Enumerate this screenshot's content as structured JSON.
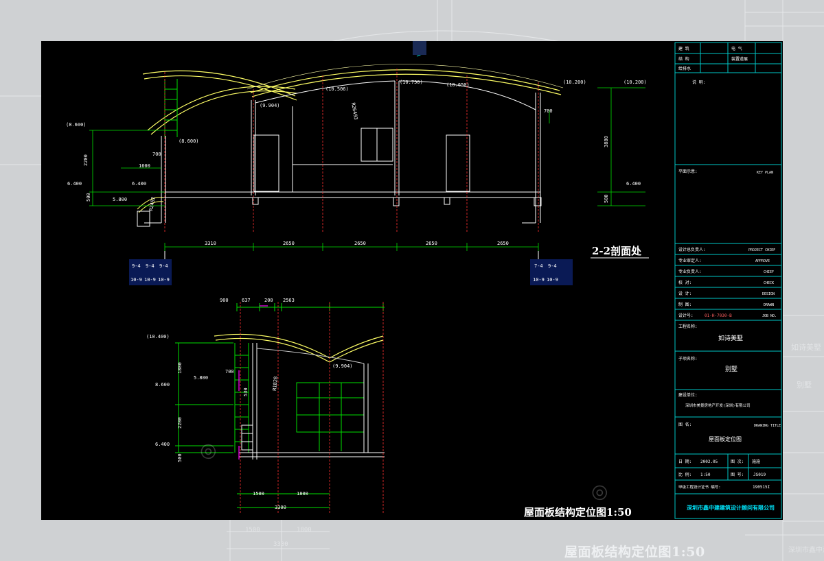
{
  "section_2_2": {
    "title": "2-2剖面处",
    "elevations": {
      "top_left": "(8.600)",
      "top_right_outer": "(10.200)",
      "top_right_inner": "(10.200)",
      "ridge_a": "(10.506)",
      "ridge_b": "(10.750)",
      "ridge_c": "(10.650)",
      "eave_a": "(9.904)",
      "eave_b": "(8.600)",
      "floor_left": "6.400",
      "floor_left2": "6.400",
      "floor_right": "6.400",
      "low_left": "5.800"
    },
    "dims_vertical": [
      "2200",
      "500",
      "3880",
      "500",
      "700"
    ],
    "dims_horizontal": [
      "3310",
      "2650",
      "2650",
      "2650",
      "2650"
    ],
    "small_dims": [
      "700",
      "1600"
    ],
    "radius_a": "R26493",
    "radius_b": "R2492",
    "axis_left": [
      "9-4",
      "9-4",
      "9-4",
      "10-9",
      "10-9",
      "10-9"
    ],
    "axis_right": [
      "7-4",
      "9-4",
      "10-9",
      "10-9"
    ]
  },
  "roof_plan": {
    "title": "屋面板结构定位图1:50",
    "elevations": {
      "top": "(10.400)",
      "eave": "(9.904)",
      "mid": "8.600",
      "low": "5.800",
      "floor": "6.400"
    },
    "dims_top": [
      "900",
      "637",
      "200",
      "2563"
    ],
    "dims_vertical": [
      "1800",
      "2200",
      "500"
    ],
    "dims_bottom": [
      "1500",
      "1800",
      "3300"
    ],
    "small_dims": [
      "700",
      "530"
    ],
    "radius": "R1828"
  },
  "title_block": {
    "rows_top": [
      {
        "a": "建 筑",
        "b": "电 气"
      },
      {
        "a": "结 构",
        "b": "装置道展"
      },
      {
        "a": "给排水",
        "b": ""
      }
    ],
    "notes_label": "说 明:",
    "key_plan_label": "平面示意:",
    "key_plan_en": "KEY PLAN",
    "staff": [
      {
        "cn": "设计总负责人:",
        "en": "PROJECT CHIEF"
      },
      {
        "cn": "专业审定人:",
        "en": "APPROVE"
      },
      {
        "cn": "专业负责人:",
        "en": "CHIEF"
      },
      {
        "cn": "校 对:",
        "en": "CHECK"
      },
      {
        "cn": "设 计:",
        "en": "DESIGN"
      },
      {
        "cn": "制 图:",
        "en": "DRAWN"
      }
    ],
    "job_no_label": "设计号:",
    "job_no": "01-H-7030-B",
    "job_no_en": "JOB NO.",
    "project_label": "工程名称:",
    "project_name": "如诗美墅",
    "subproject_label": "子项名称:",
    "subproject_name": "别墅",
    "client_label": "建设单位:",
    "client_name": "深圳市美景房地产开发(深圳)有限公司",
    "drawing_label": "图 名:",
    "drawing_en": "DRAWING TITLE",
    "drawing_title": "屋面板定位图",
    "date_label": "日 期:",
    "date": "2002.05",
    "scale_label": "比 例:",
    "scale": "1:50",
    "phase_label": "图 次:",
    "phase": "施施",
    "sheet_label": "图 号:",
    "sheet_no": "JS019",
    "cert_label": "甲级工程设计证书 编号:",
    "cert_no": "190515I",
    "firm": "深圳市鑫中建建筑设计顾问有限公司"
  },
  "background": {
    "ghost_title": "屋面板结构定位图1:50",
    "ghost_dims": [
      "1500",
      "1800",
      "3300"
    ],
    "ghost_side": [
      "如诗美墅",
      "别墅",
      "深圳市鑫中建建筑设计顾"
    ]
  },
  "colors": {
    "line_green": "#00e000",
    "line_yellow": "#ffff66",
    "line_red": "#ff3030",
    "line_cyan": "#00c8c8",
    "line_white": "#ffffff",
    "line_blue": "#3060ff",
    "sheet_bg": "#000000",
    "page_bg": "#cfd1d3"
  }
}
